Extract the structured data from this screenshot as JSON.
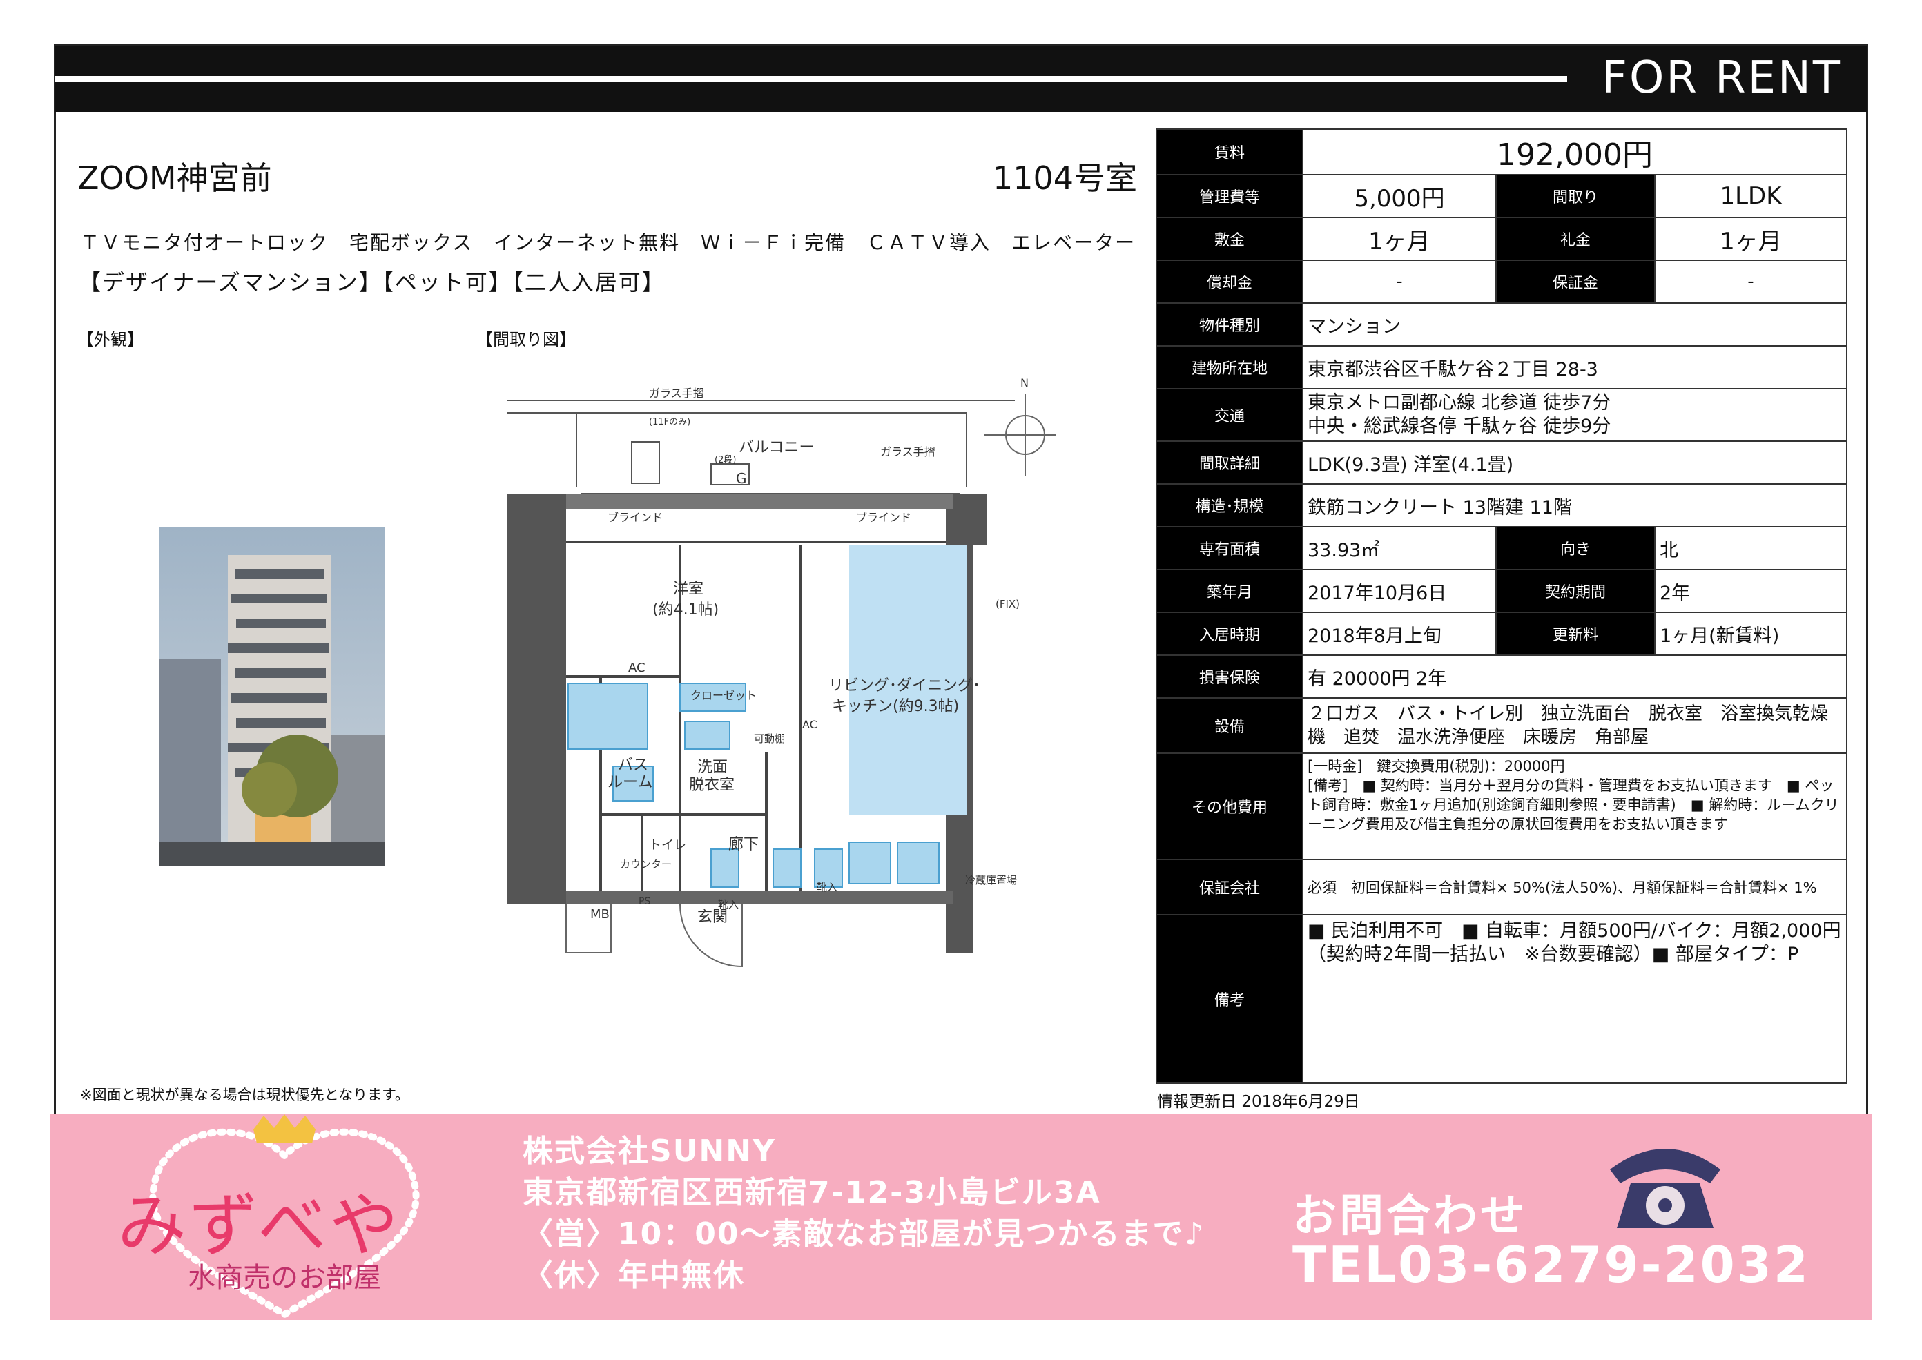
{
  "header": {
    "title": "FOR RENT"
  },
  "property": {
    "name": "ZOOM神宮前",
    "room": "1104号室",
    "features": "ＴＶモニタ付オートロック　宅配ボックス　インターネット無料　Ｗｉ－Ｆｉ完備　ＣＡＴＶ導入　エレベーター",
    "tags": "【デザイナーズマンション】【ペット可】【二人入居可】"
  },
  "labels": {
    "exterior": "【外観】",
    "floorplan": "【間取り図】"
  },
  "floorplan_labels": {
    "balcony": "バルコニー",
    "glass_rail": "ガラス手摺",
    "blind": "ブラインド",
    "western": "洋室",
    "western_size": "(約4.1帖)",
    "ldk": "リビング･ダイニング･",
    "ldk2": "キッチン(約9.3帖)",
    "closet": "クローゼット",
    "movable": "可動棚",
    "bath": "バス",
    "bath2": "ルーム",
    "wash": "洗面",
    "wash2": "脱衣室",
    "toilet": "トイレ",
    "hall": "廊下",
    "entrance": "玄関",
    "shoes": "靴入",
    "mb": "MB",
    "ps": "PS",
    "ac": "AC",
    "g": "G",
    "storage": "冷蔵庫置場",
    "fix": "(FIX)",
    "n": "N",
    "note11f": "(11Fのみ)",
    "note2": "(2段)",
    "kaunta": "カウンター",
    "shoes2": "靴入"
  },
  "table": {
    "rent_label": "賃料",
    "rent": "192,000円",
    "mgmt_label": "管理費等",
    "mgmt": "5,000円",
    "layout_label": "間取り",
    "layout": "1LDK",
    "deposit_label": "敷金",
    "deposit": "1ヶ月",
    "key_label": "礼金",
    "key": "1ヶ月",
    "amort_label": "償却金",
    "amort": "-",
    "guarantee_label": "保証金",
    "guarantee": "-",
    "type_label": "物件種別",
    "type": "マンション",
    "address_label": "建物所在地",
    "address": "東京都渋谷区千駄ケ谷２丁目 28-3",
    "transport_label": "交通",
    "transport1": "東京メトロ副都心線 北参道 徒歩7分",
    "transport2": "中央・総武線各停 千駄ヶ谷 徒歩9分",
    "layout_detail_label": "間取詳細",
    "layout_detail": "LDK(9.3畳) 洋室(4.1畳)",
    "structure_label": "構造･規模",
    "structure": "鉄筋コンクリート 13階建 11階",
    "area_label": "専有面積",
    "area": "33.93㎡",
    "facing_label": "向き",
    "facing": "北",
    "built_label": "築年月",
    "built": "2017年10月6日",
    "term_label": "契約期間",
    "term": "2年",
    "movein_label": "入居時期",
    "movein": "2018年8月上旬",
    "renewal_label": "更新料",
    "renewal": "1ヶ月(新賃料)",
    "insurance_label": "損害保険",
    "insurance": "有  20000円 2年",
    "equip_label": "設備",
    "equip": "２口ガス　バス・トイレ別　独立洗面台　脱衣室　浴室換気乾燥機　追焚　温水洗浄便座　床暖房　角部屋",
    "other_label": "その他費用",
    "other1": "[一時金]　鍵交換費用(税別)：20000円",
    "other2": "[備考]　■ 契約時：当月分＋翌月分の賃料・管理費をお支払い頂きます　■ ペット飼育時：敷金1ヶ月追加(別途飼育細則参照・要申請書)　■ 解約時：ルームクリーニング費用及び借主負担分の原状回復費用をお支払い頂きます",
    "guar_co_label": "保証会社",
    "guar_co": "必須　初回保証料＝合計賃料× 50%(法人50%)、月額保証料＝合計賃料× 1%",
    "remarks_label": "備考",
    "remarks": "■ 民泊利用不可　■ 自転車：月額500円/バイク：月額2,000円（契約時2年間一括払い　※台数要確認）■ 部屋タイプ：P"
  },
  "note": "※図面と現状が異なる場合は現状優先となります。",
  "updated": "情報更新日 2018年6月29日",
  "banner": {
    "logo": "みずべや",
    "logo_sub": "水商売のお部屋",
    "company": "株式会社SUNNY",
    "address": "東京都新宿区西新宿7-12-3小島ビル3A",
    "hours": "〈営〉10：00～素敵なお部屋が見つかるまで♪",
    "holiday": "〈休〉年中無休",
    "contact": "お問合わせ",
    "tel": "TEL03-6279-2032"
  }
}
